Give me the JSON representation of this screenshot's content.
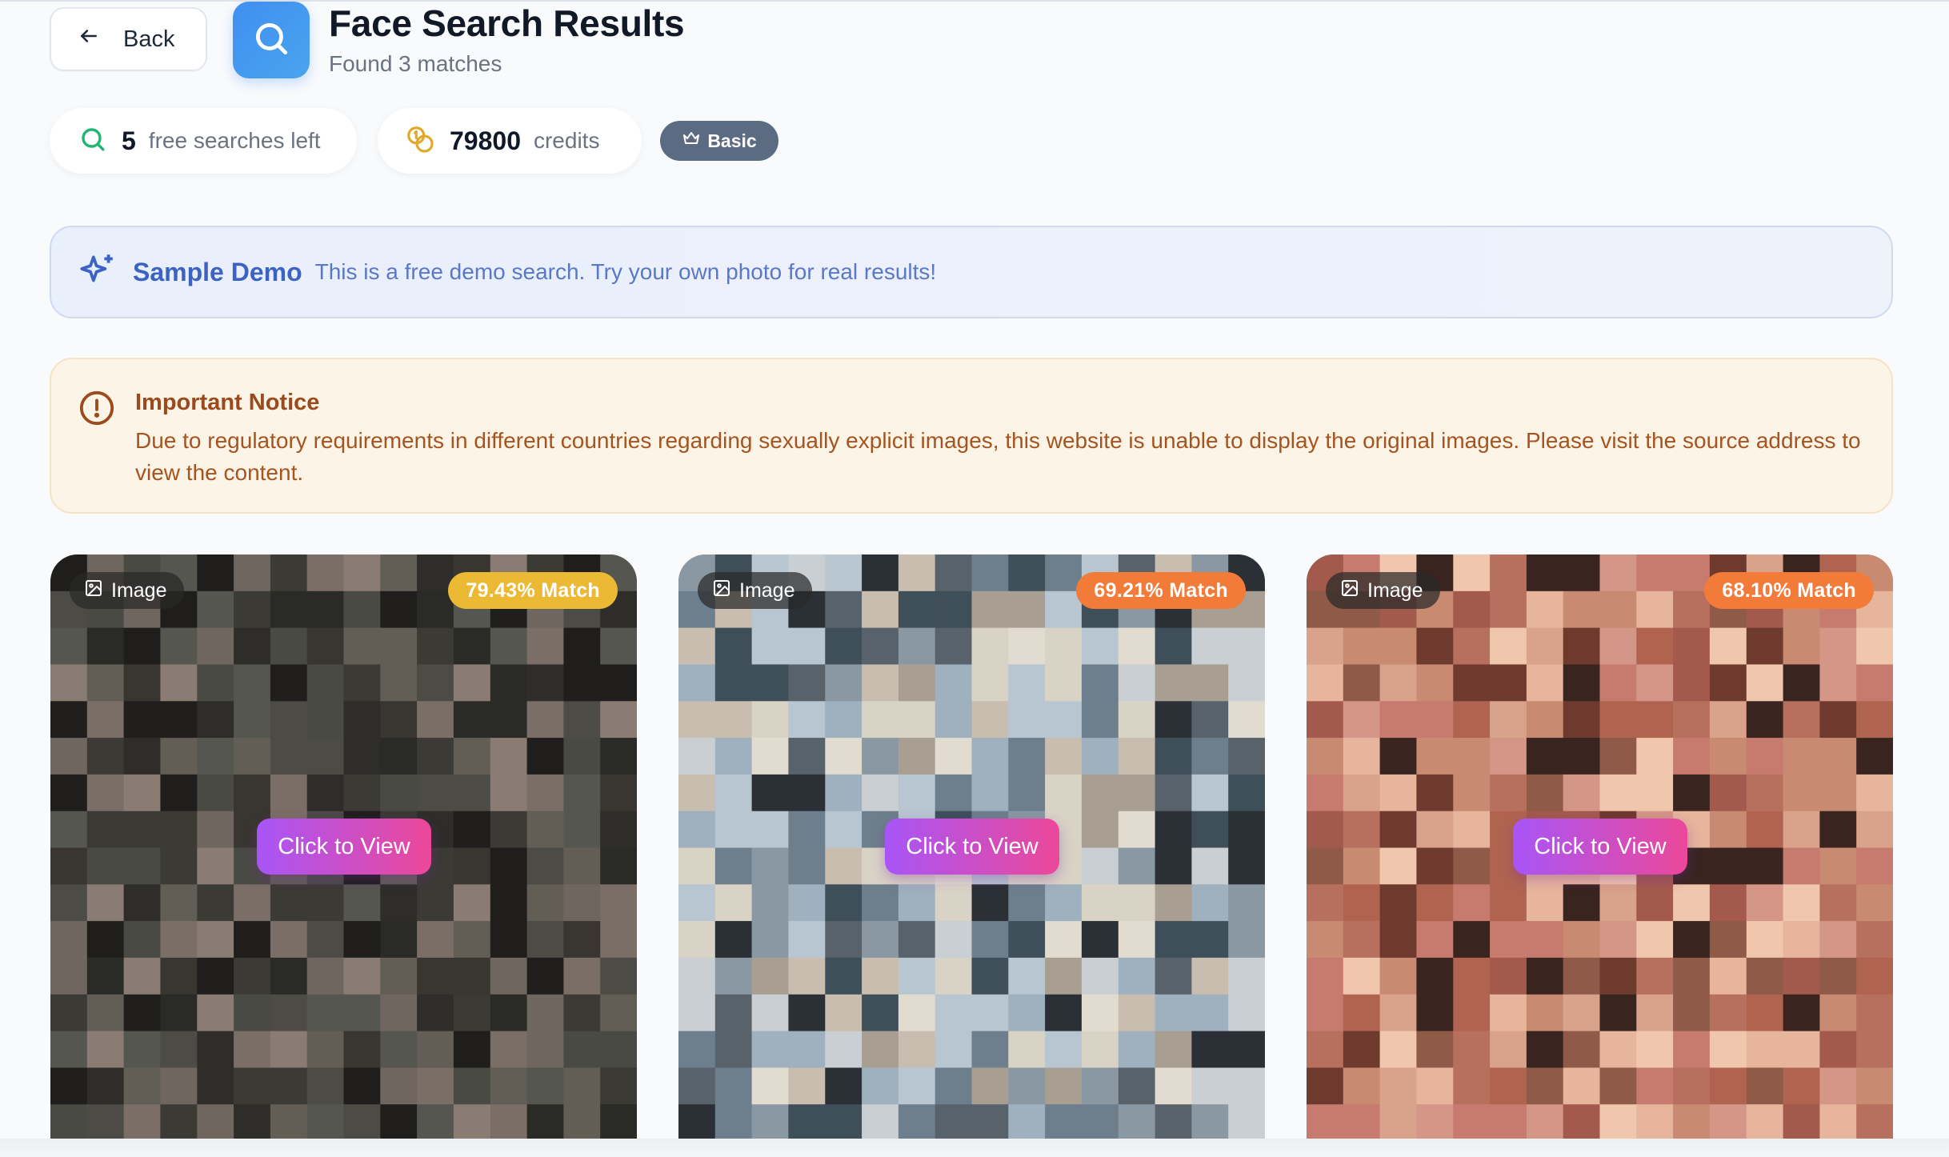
{
  "header": {
    "back_label": "Back",
    "title": "Face Search Results",
    "subtitle": "Found 3 matches"
  },
  "stats": {
    "free_searches_count": "5",
    "free_searches_label": "free searches left",
    "credits_count": "79800",
    "credits_label": "credits",
    "plan_label": "Basic"
  },
  "demo_banner": {
    "title": "Sample Demo",
    "text": "This is a free demo search. Try your own photo for real results!"
  },
  "notice": {
    "title": "Important Notice",
    "text": "Due to regulatory requirements in different countries regarding sexually explicit images, this website is unable to display the original images. Please visit the source address to view the content."
  },
  "results": [
    {
      "type_label": "Image",
      "match_label": "79.43% Match",
      "match_color": "#ecb935",
      "view_label": "Click to View"
    },
    {
      "type_label": "Image",
      "match_label": "69.21% Match",
      "match_color": "#f27b3a",
      "view_label": "Click to View"
    },
    {
      "type_label": "Image",
      "match_label": "68.10% Match",
      "match_color": "#f27b3a",
      "view_label": "Click to View"
    }
  ],
  "colors": {
    "accent_blue": "#3f8ff0",
    "plan_badge": "#5b6b82",
    "view_gradient_start": "#a855f7",
    "view_gradient_end": "#ec4899"
  }
}
